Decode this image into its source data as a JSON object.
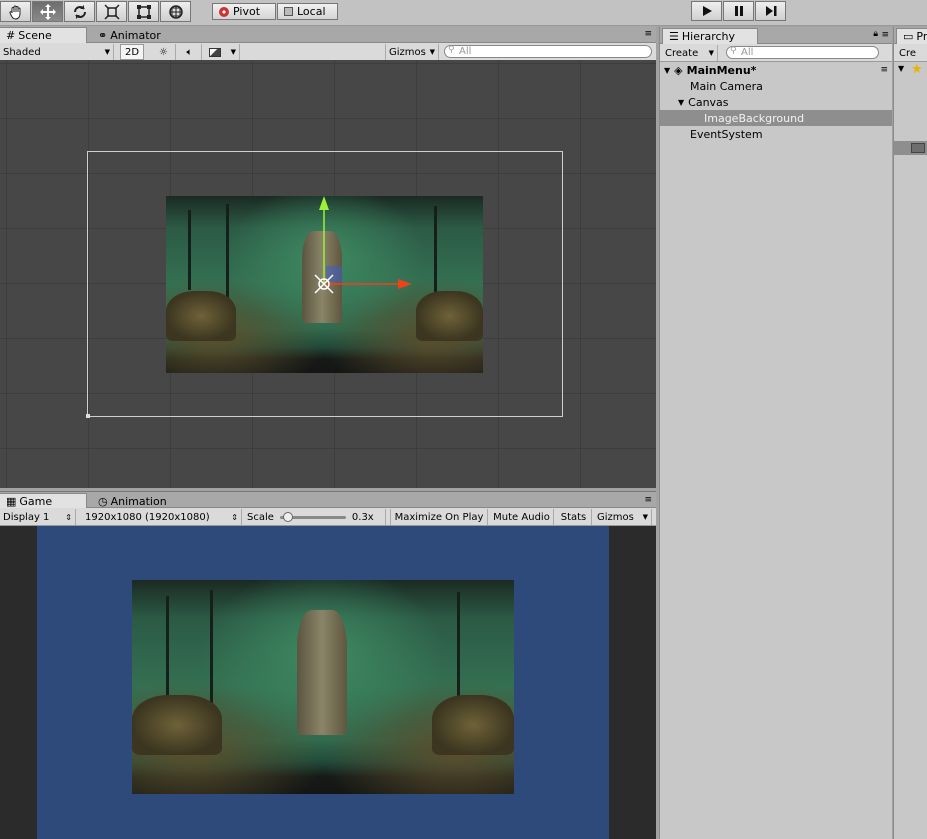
{
  "toolbar": {
    "tools": [
      "hand-tool",
      "move-tool",
      "rotate-tool",
      "scale-tool",
      "rect-tool",
      "transform-tool"
    ],
    "pivot_label": "Pivot",
    "local_label": "Local"
  },
  "scene": {
    "tab_label": "Scene",
    "animator_tab_label": "Animator",
    "shading_mode": "Shaded",
    "mode_2d": "2D",
    "gizmos_label": "Gizmos",
    "search_placeholder": "All"
  },
  "game": {
    "tab_label": "Game",
    "animation_tab_label": "Animation",
    "display": "Display 1",
    "resolution": "1920x1080 (1920x1080)",
    "scale_label": "Scale",
    "scale_value": "0.3x",
    "scale_fraction": 0.05,
    "maximize_label": "Maximize On Play",
    "mute_label": "Mute Audio",
    "stats_label": "Stats",
    "gizmos_label": "Gizmos"
  },
  "hierarchy": {
    "tab_label": "Hierarchy",
    "create_label": "Create",
    "search_placeholder": "All",
    "scene_name": "MainMenu*",
    "items": [
      {
        "label": "Main Camera"
      },
      {
        "label": "Canvas"
      },
      {
        "label": "ImageBackground"
      },
      {
        "label": "EventSystem"
      }
    ]
  },
  "project": {
    "tab_label": "Pr",
    "create_label": "Cre"
  },
  "colors": {
    "scene_bg": "#474747",
    "game_bg": "#2e4a7a",
    "selection": "#8e8e8e",
    "gizmo_y": "#9cf03a",
    "gizmo_x": "#f0411c"
  }
}
